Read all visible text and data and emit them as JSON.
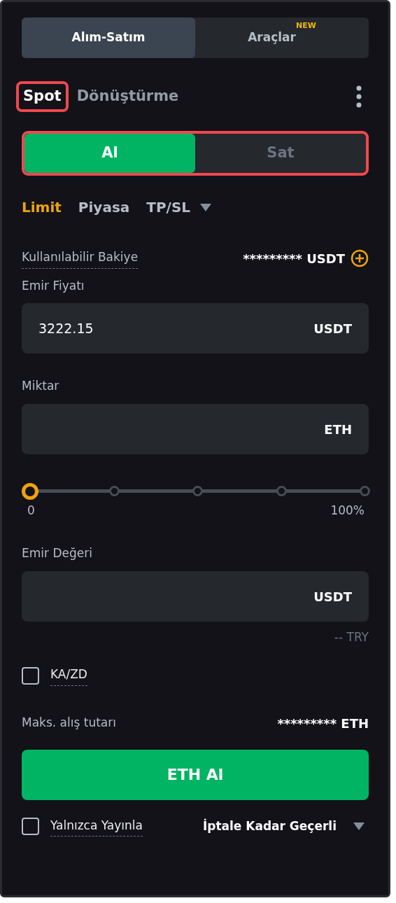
{
  "top_tabs": [
    {
      "label": "Alım-Satım",
      "selected": true
    },
    {
      "label": "Araçlar",
      "badge": "NEW",
      "selected": false
    }
  ],
  "mode_tabs": [
    {
      "label": "Spot",
      "selected": true,
      "highlighted": true
    },
    {
      "label": "Dönüştürme",
      "selected": false,
      "highlighted": false
    }
  ],
  "side_toggle": {
    "highlighted": true,
    "options": [
      {
        "label": "Al",
        "selected": true
      },
      {
        "label": "Sat",
        "selected": false
      }
    ]
  },
  "order_types": [
    {
      "label": "Limit",
      "selected": true,
      "dropdown": false
    },
    {
      "label": "Piyasa",
      "selected": false,
      "dropdown": false
    },
    {
      "label": "TP/SL",
      "selected": false,
      "dropdown": true
    }
  ],
  "balance": {
    "label": "Kullanılabilir Bakiye",
    "value": "********* USDT"
  },
  "fields": [
    {
      "label": "Emir Fiyatı",
      "value": "3222.15",
      "unit": "USDT"
    },
    {
      "label": "Miktar",
      "unit": "ETH"
    }
  ],
  "slider": {
    "level": 0,
    "min_label": "0",
    "max_label": "100%"
  },
  "order_value": {
    "label": "Emir Değeri",
    "unit": "USDT",
    "conversion": "-- TRY"
  },
  "tpsl_checkbox": {
    "label": "KA/ZD",
    "checked": false
  },
  "max_buy": {
    "label": "Maks. alış tutarı",
    "value": "********* ETH"
  },
  "submit_button": "ETH Al",
  "post_only": {
    "label": "Yalnızca Yayınla",
    "checked": false
  },
  "time_in_force": "İptale Kadar Geçerli"
}
